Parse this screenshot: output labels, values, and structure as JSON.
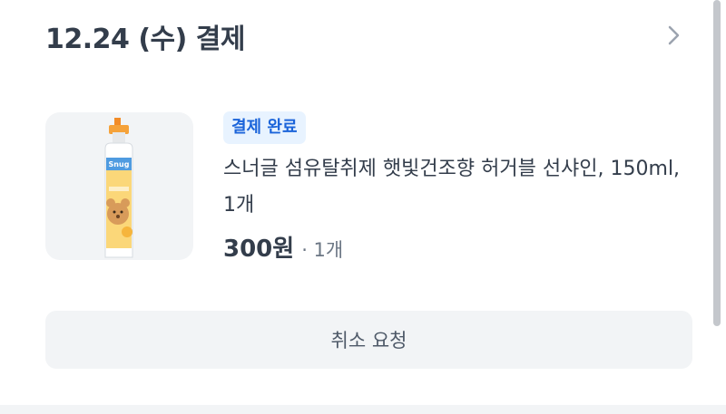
{
  "order": {
    "title": "12.24 (수) 결제",
    "chevron_icon": "chevron-right-icon"
  },
  "product": {
    "image_icon": "fabric-spray-bottle-image",
    "status": "결제 완료",
    "name": "스너글 섬유탈취제 햇빛건조향 허거블 선샤인, 150ml, 1개",
    "price": "300원",
    "quantity": "· 1개"
  },
  "actions": {
    "cancel_label": "취소 요청"
  },
  "colors": {
    "badge_bg": "#e8f3ff",
    "badge_text": "#1b64da",
    "button_bg": "#f2f4f6",
    "title_text": "#333d4b"
  }
}
